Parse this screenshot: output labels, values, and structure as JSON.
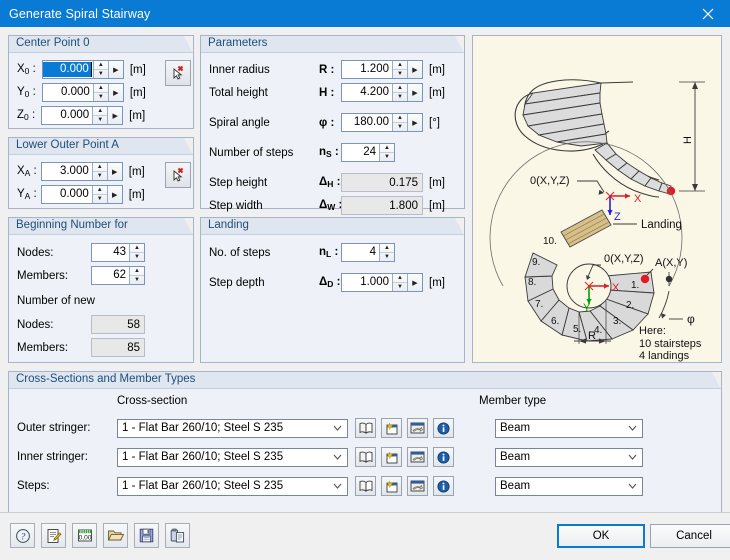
{
  "window": {
    "title": "Generate Spiral Stairway",
    "close_icon": "close-icon"
  },
  "center_point": {
    "legend": "Center Point 0",
    "fields": [
      {
        "label": "X",
        "sub": "0",
        "colon": ":",
        "value": "0.000",
        "unit": "[m]",
        "selected": true
      },
      {
        "label": "Y",
        "sub": "0",
        "colon": ":",
        "value": "0.000",
        "unit": "[m]",
        "selected": false
      },
      {
        "label": "Z",
        "sub": "0",
        "colon": ":",
        "value": "0.000",
        "unit": "[m]",
        "selected": false
      }
    ],
    "pick_icon": "pick-point-icon"
  },
  "lower_outer_point": {
    "legend": "Lower Outer Point A",
    "fields": [
      {
        "label": "X",
        "sub": "A",
        "colon": ":",
        "value": "3.000",
        "unit": "[m]"
      },
      {
        "label": "Y",
        "sub": "A",
        "colon": ":",
        "value": "0.000",
        "unit": "[m]"
      }
    ],
    "pick_icon": "pick-point-icon"
  },
  "beginning_number": {
    "legend": "Beginning Number for",
    "nodes_label": "Nodes:",
    "nodes_value": "43",
    "members_label": "Members:",
    "members_value": "62",
    "new_heading": "Number of new",
    "new_nodes_label": "Nodes:",
    "new_nodes_value": "58",
    "new_members_label": "Members:",
    "new_members_value": "85"
  },
  "parameters": {
    "legend": "Parameters",
    "rows": [
      {
        "label": "Inner radius",
        "sym": "R",
        "sub": "",
        "colon": ":",
        "value": "1.200",
        "unit": "[m]",
        "readonly": false,
        "more": true
      },
      {
        "label": "Total height",
        "sym": "H",
        "sub": "",
        "colon": ":",
        "value": "4.200",
        "unit": "[m]",
        "readonly": false,
        "more": true
      },
      {
        "label": "Spiral angle",
        "sym": "φ",
        "sub": "",
        "colon": ":",
        "value": "180.00",
        "unit": "[°]",
        "readonly": false,
        "more": true
      },
      {
        "label": "Number of steps",
        "sym": "n",
        "sub": "S",
        "colon": ":",
        "value": "24",
        "unit": "",
        "readonly": false,
        "more": false
      },
      {
        "label": "Step height",
        "sym": "Δ",
        "sub": "H",
        "colon": ":",
        "value": "0.175",
        "unit": "[m]",
        "readonly": true,
        "more": false
      },
      {
        "label": "Step width",
        "sym": "Δ",
        "sub": "W",
        "colon": ":",
        "value": "1.800",
        "unit": "[m]",
        "readonly": true,
        "more": false
      }
    ]
  },
  "landing": {
    "legend": "Landing",
    "rows": [
      {
        "label": "No. of steps",
        "sym": "n",
        "sub": "L",
        "colon": ":",
        "value": "4",
        "unit": "",
        "more": false
      },
      {
        "label": "Step depth",
        "sym": "Δ",
        "sub": "D",
        "colon": ":",
        "value": "1.000",
        "unit": "[m]",
        "more": true
      }
    ]
  },
  "diagram": {
    "labels": {
      "height_dim": "H",
      "origin_3d": "0(X,Y,Z)",
      "origin_plan": "0(X,Y,Z)",
      "point_a": "A(X,Y)",
      "landing": "Landing",
      "radius": "R",
      "angle": "φ",
      "axis_x_3d": "X",
      "axis_z_3d": "Z",
      "axis_x_plan": "X",
      "axis_y_plan": "Y",
      "note_line1": "Here:",
      "note_line2": "10 stairsteps",
      "note_line3": "4 landings"
    },
    "step_numbers": [
      "1.",
      "2.",
      "3.",
      "4.",
      "5.",
      "6.",
      "7.",
      "8.",
      "9.",
      "10."
    ]
  },
  "cross_sections": {
    "legend": "Cross-Sections and Member Types",
    "col_cross_section": "Cross-section",
    "col_member_type": "Member type",
    "rows": [
      {
        "label": "Outer stringer:",
        "cross_section": "1 - Flat Bar 260/10; Steel S 235",
        "member_type": "Beam"
      },
      {
        "label": "Inner stringer:",
        "cross_section": "1 - Flat Bar 260/10; Steel S 235",
        "member_type": "Beam"
      },
      {
        "label": "Steps:",
        "cross_section": "1 - Flat Bar 260/10; Steel S 235",
        "member_type": "Beam"
      }
    ],
    "row_icons": [
      "library-icon",
      "new-section-icon",
      "import-section-icon",
      "info-icon"
    ]
  },
  "footer": {
    "tools": [
      "help-icon",
      "edit-icon",
      "units-icon",
      "open-icon",
      "save-icon",
      "clipboard-icon"
    ],
    "ok_label": "OK",
    "cancel_label": "Cancel"
  },
  "colors": {
    "title_bar": "#0a7bd4",
    "accent": "#0a7bd4",
    "group_border": "#a6b3cc",
    "group_bg": "#eef1f7",
    "diagram_bg": "#fbf7e6",
    "marker_red": "#e01b24",
    "axis_x": "#d81f26",
    "axis_y": "#00a000",
    "axis_z": "#2424d8",
    "landing_fill": "#d7bf8a"
  }
}
